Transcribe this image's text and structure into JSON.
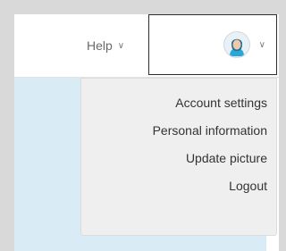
{
  "header": {
    "help_label": "Help",
    "help_chevron": "⌄",
    "user_chevron": "⌄",
    "avatar_icon": "user-avatar-icon"
  },
  "user_menu": {
    "items": [
      {
        "label": "Account settings"
      },
      {
        "label": "Personal information"
      },
      {
        "label": "Update picture"
      },
      {
        "label": "Logout"
      }
    ]
  },
  "colors": {
    "background": "#d9d9d9",
    "content_area": "#d9ebf4",
    "menu_background": "#efefef",
    "avatar_accent": "#2aa7d9"
  }
}
